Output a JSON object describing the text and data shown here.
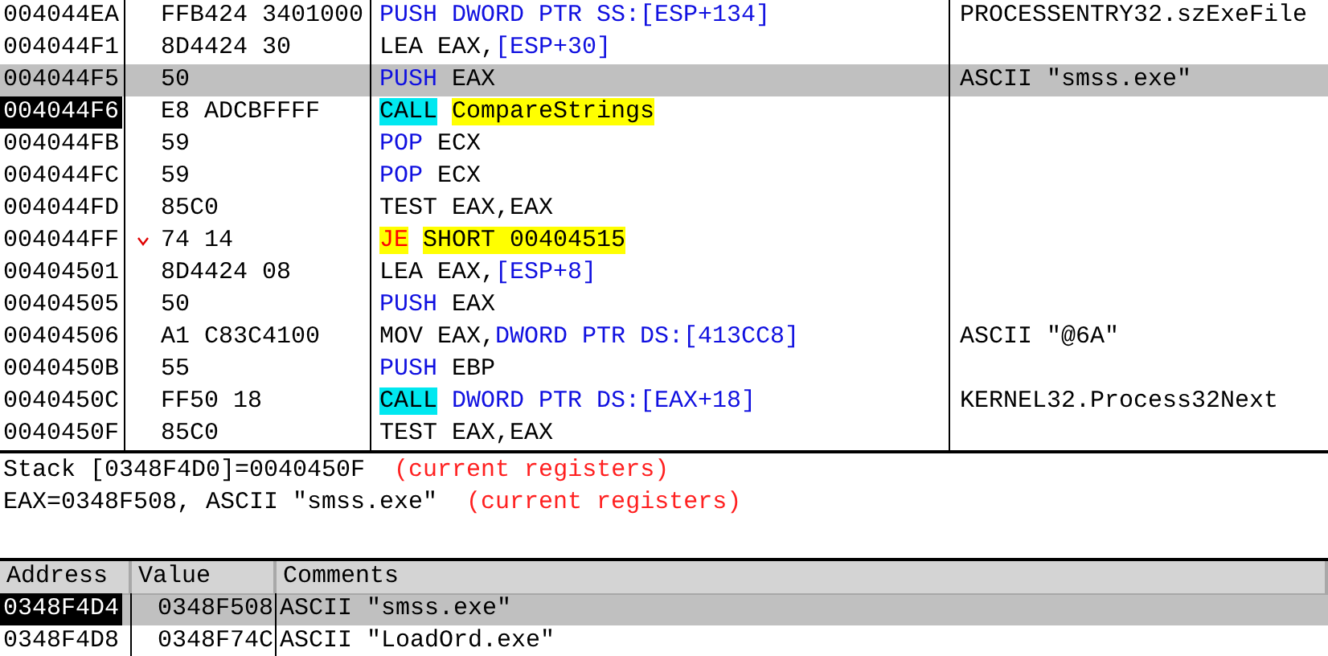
{
  "disassembly": {
    "rows": [
      {
        "address": "004044EA",
        "hex": "FFB424 3401000",
        "mnemonic": {
          "text": "PUSH",
          "kind": "stack"
        },
        "operands": [
          {
            "text": "DWORD PTR SS:[ESP+134]",
            "kind": "memory"
          }
        ],
        "comment": "PROCESSENTRY32.szExeFile",
        "selected": false,
        "current": false,
        "jump_mark": false
      },
      {
        "address": "004044F1",
        "hex": "8D4424 30",
        "mnemonic": {
          "text": "LEA",
          "kind": "plain"
        },
        "operands": [
          {
            "text": "EAX,",
            "kind": "plain"
          },
          {
            "text": "[ESP+30]",
            "kind": "memory"
          }
        ],
        "selected": false,
        "current": false,
        "jump_mark": false
      },
      {
        "address": "004044F5",
        "hex": "50",
        "mnemonic": {
          "text": "PUSH",
          "kind": "stack"
        },
        "operands": [
          {
            "text": "EAX",
            "kind": "plain"
          }
        ],
        "comment": "ASCII \"smss.exe\"",
        "selected": true,
        "current": false,
        "jump_mark": false
      },
      {
        "address": "004044F6",
        "hex": "E8 ADCBFFFF",
        "mnemonic": {
          "text": "CALL",
          "kind": "call"
        },
        "operands": [
          {
            "text": "CompareStrings",
            "kind": "target"
          }
        ],
        "selected": false,
        "current": true,
        "jump_mark": false
      },
      {
        "address": "004044FB",
        "hex": "59",
        "mnemonic": {
          "text": "POP",
          "kind": "stack"
        },
        "operands": [
          {
            "text": "ECX",
            "kind": "plain"
          }
        ],
        "selected": false,
        "current": false,
        "jump_mark": false
      },
      {
        "address": "004044FC",
        "hex": "59",
        "mnemonic": {
          "text": "POP",
          "kind": "stack"
        },
        "operands": [
          {
            "text": "ECX",
            "kind": "plain"
          }
        ],
        "selected": false,
        "current": false,
        "jump_mark": false
      },
      {
        "address": "004044FD",
        "hex": "85C0",
        "mnemonic": {
          "text": "TEST",
          "kind": "plain"
        },
        "operands": [
          {
            "text": "EAX,EAX",
            "kind": "plain"
          }
        ],
        "selected": false,
        "current": false,
        "jump_mark": false
      },
      {
        "address": "004044FF",
        "hex": "74 14",
        "mnemonic": {
          "text": "JE",
          "kind": "jump"
        },
        "operands": [
          {
            "text": "SHORT 00404515",
            "kind": "target"
          }
        ],
        "selected": false,
        "current": false,
        "jump_mark": true
      },
      {
        "address": "00404501",
        "hex": "8D4424 08",
        "mnemonic": {
          "text": "LEA",
          "kind": "plain"
        },
        "operands": [
          {
            "text": "EAX,",
            "kind": "plain"
          },
          {
            "text": "[ESP+8]",
            "kind": "memory"
          }
        ],
        "selected": false,
        "current": false,
        "jump_mark": false
      },
      {
        "address": "00404505",
        "hex": "50",
        "mnemonic": {
          "text": "PUSH",
          "kind": "stack"
        },
        "operands": [
          {
            "text": "EAX",
            "kind": "plain"
          }
        ],
        "selected": false,
        "current": false,
        "jump_mark": false
      },
      {
        "address": "00404506",
        "hex": "A1 C83C4100",
        "mnemonic": {
          "text": "MOV",
          "kind": "plain"
        },
        "operands": [
          {
            "text": "EAX,",
            "kind": "plain"
          },
          {
            "text": "DWORD PTR DS:[413CC8]",
            "kind": "memory"
          }
        ],
        "comment": "ASCII \"@6A\"",
        "selected": false,
        "current": false,
        "jump_mark": false
      },
      {
        "address": "0040450B",
        "hex": "55",
        "mnemonic": {
          "text": "PUSH",
          "kind": "stack"
        },
        "operands": [
          {
            "text": "EBP",
            "kind": "plain"
          }
        ],
        "selected": false,
        "current": false,
        "jump_mark": false
      },
      {
        "address": "0040450C",
        "hex": "FF50 18",
        "mnemonic": {
          "text": "CALL",
          "kind": "call"
        },
        "operands": [
          {
            "text": "DWORD PTR DS:[EAX+18]",
            "kind": "memory"
          }
        ],
        "comment": "KERNEL32.Process32Next",
        "selected": false,
        "current": false,
        "jump_mark": false
      },
      {
        "address": "0040450F",
        "hex": "85C0",
        "mnemonic": {
          "text": "TEST",
          "kind": "plain"
        },
        "operands": [
          {
            "text": "EAX,EAX",
            "kind": "plain"
          }
        ],
        "selected": false,
        "current": false,
        "jump_mark": false
      }
    ]
  },
  "info": {
    "lines": [
      [
        {
          "text": "Stack [0348F4D0]=0040450F",
          "kind": "plain"
        },
        {
          "text": "(current registers)",
          "kind": "note"
        }
      ],
      [
        {
          "text": "EAX=0348F508, ASCII \"smss.exe\"",
          "kind": "plain"
        },
        {
          "text": "(current registers)",
          "kind": "note"
        }
      ]
    ]
  },
  "stack": {
    "columns": [
      "Address",
      "Value",
      "Comments"
    ],
    "rows": [
      {
        "address": "0348F4D4",
        "value": "0348F508",
        "comment": "ASCII \"smss.exe\"",
        "selected": true,
        "current": true
      },
      {
        "address": "0348F4D8",
        "value": "0348F74C",
        "comment": "ASCII \"LoadOrd.exe\"",
        "selected": false,
        "current": false
      }
    ]
  }
}
